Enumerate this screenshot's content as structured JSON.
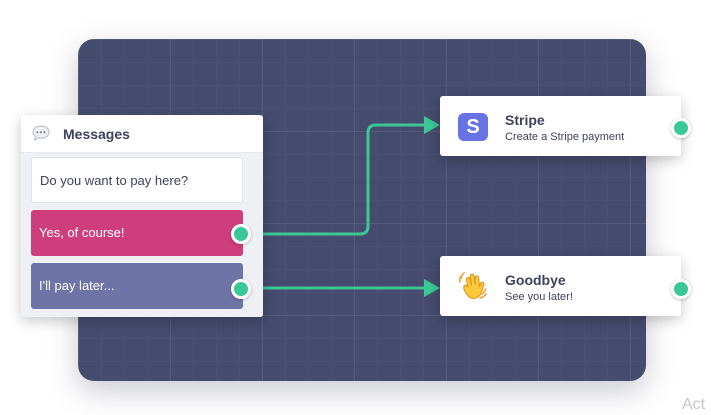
{
  "messages_block": {
    "title": "Messages",
    "header_icon": "chat-bubble-icon",
    "items": [
      {
        "label": "Do you want to pay here?",
        "color": "#ffffff"
      },
      {
        "label": "Yes, of course!",
        "color": "#cf3e7c"
      },
      {
        "label": "I'll pay later...",
        "color": "#6f74a6"
      }
    ]
  },
  "nodes": {
    "stripe": {
      "title": "Stripe",
      "subtitle": "Create a Stripe payment",
      "icon": "stripe-logo-icon",
      "icon_letter": "S",
      "icon_color": "#6772e5"
    },
    "goodbye": {
      "title": "Goodbye",
      "subtitle": "See you later!",
      "icon": "waving-hand-icon"
    }
  },
  "theme": {
    "canvas_color": "#454c6d",
    "connector_color": "#3ac996"
  },
  "watermark": "Act"
}
